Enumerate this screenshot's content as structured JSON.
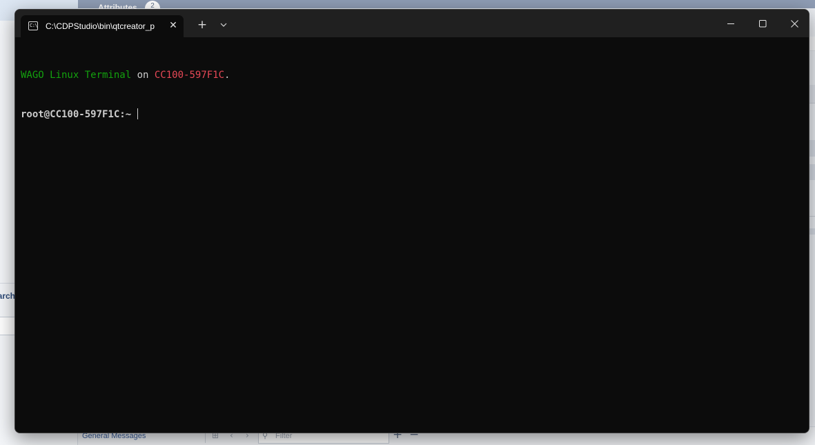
{
  "background_app": {
    "panel_title": "Attributes",
    "panel_badge": "2",
    "left_search_label": "Search",
    "bottom_bar": {
      "output_pane_label": "General Messages",
      "filter_placeholder": "Filter",
      "add_label": "+",
      "remove_label": "−"
    }
  },
  "terminal": {
    "tab": {
      "title": "C:\\CDPStudio\\bin\\qtcreator_p",
      "icon": "cmd-prompt-icon",
      "close_icon": "close-icon"
    },
    "titlebar": {
      "new_tab_label": "+",
      "dropdown_icon": "chevron-down-icon",
      "minimize_icon": "minimize-icon",
      "maximize_icon": "maximize-icon",
      "close_icon": "close-icon"
    },
    "output": {
      "banner": {
        "part1": "WAGO Linux Terminal",
        "part2": " on ",
        "part3": "CC100-597F1C",
        "part4": "."
      },
      "prompt": "root@CC100-597F1C:~ "
    },
    "colors": {
      "background": "#0c0c0c",
      "titlebar": "#202020",
      "green": "#13a10e",
      "red": "#e74856",
      "text": "#cccccc"
    }
  }
}
